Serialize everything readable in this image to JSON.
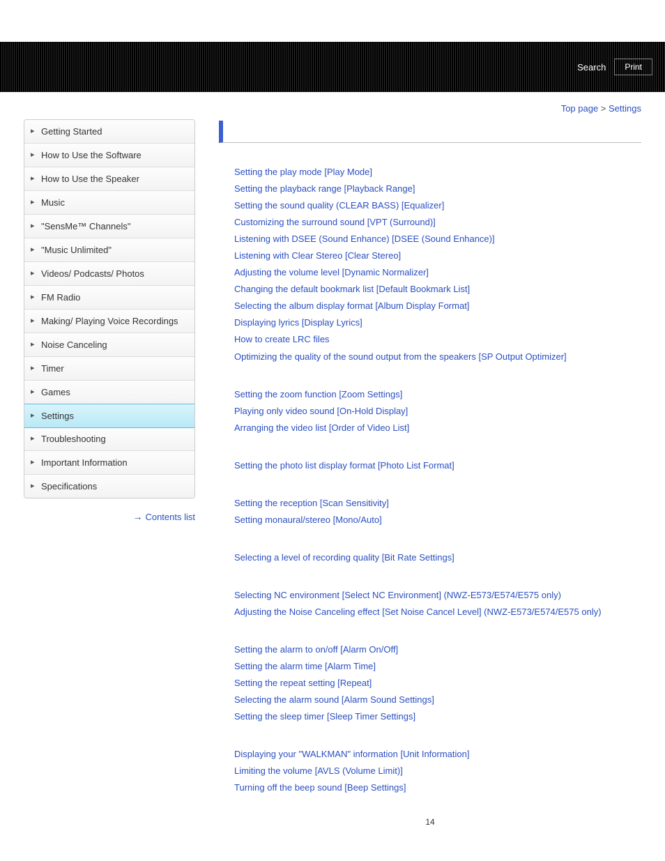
{
  "header": {
    "search_label": "Search",
    "print_label": "Print"
  },
  "breadcrumb": {
    "top_label": "Top page",
    "sep": " > ",
    "current": "Settings"
  },
  "sidebar": {
    "items": [
      {
        "label": "Getting Started"
      },
      {
        "label": "How to Use the Software"
      },
      {
        "label": "How to Use the Speaker"
      },
      {
        "label": "Music"
      },
      {
        "label": "\"SensMe™ Channels\""
      },
      {
        "label": "\"Music Unlimited\""
      },
      {
        "label": "Videos/ Podcasts/ Photos"
      },
      {
        "label": "FM Radio"
      },
      {
        "label": "Making/ Playing Voice Recordings"
      },
      {
        "label": "Noise Canceling"
      },
      {
        "label": "Timer"
      },
      {
        "label": "Games"
      },
      {
        "label": "Settings"
      },
      {
        "label": "Troubleshooting"
      },
      {
        "label": "Important Information"
      },
      {
        "label": "Specifications"
      }
    ],
    "active_index": 12,
    "contents_list_label": "Contents list"
  },
  "groups": [
    [
      "Setting the play mode [Play Mode]",
      "Setting the playback range [Playback Range]",
      "Setting the sound quality (CLEAR BASS) [Equalizer]",
      "Customizing the surround sound [VPT (Surround)]",
      "Listening with DSEE (Sound Enhance) [DSEE (Sound Enhance)]",
      "Listening with Clear Stereo [Clear Stereo]",
      "Adjusting the volume level [Dynamic Normalizer]",
      "Changing the default bookmark list [Default Bookmark List]",
      "Selecting the album display format [Album Display Format]",
      "Displaying lyrics [Display Lyrics]",
      "How to create LRC files",
      "Optimizing the quality of the sound output from the speakers [SP Output Optimizer]"
    ],
    [
      "Setting the zoom function [Zoom Settings]",
      "Playing only video sound [On-Hold Display]",
      "Arranging the video list [Order of Video List]"
    ],
    [
      "Setting the photo list display format [Photo List Format]"
    ],
    [
      "Setting the reception [Scan Sensitivity]",
      "Setting monaural/stereo [Mono/Auto]"
    ],
    [
      "Selecting a level of recording quality [Bit Rate Settings]"
    ],
    [
      "Selecting NC environment [Select NC Environment] (NWZ-E573/E574/E575 only)",
      "Adjusting the Noise Canceling effect [Set Noise Cancel Level] (NWZ-E573/E574/E575 only)"
    ],
    [
      "Setting the alarm to on/off [Alarm On/Off]",
      "Setting the alarm time [Alarm Time]",
      "Setting the repeat setting [Repeat]",
      "Selecting the alarm sound [Alarm Sound Settings]",
      "Setting the sleep timer [Sleep Timer Settings]"
    ],
    [
      "Displaying your \"WALKMAN\" information [Unit Information]",
      "Limiting the volume [AVLS (Volume Limit)]",
      "Turning off the beep sound [Beep Settings]"
    ]
  ],
  "page_number": "14"
}
